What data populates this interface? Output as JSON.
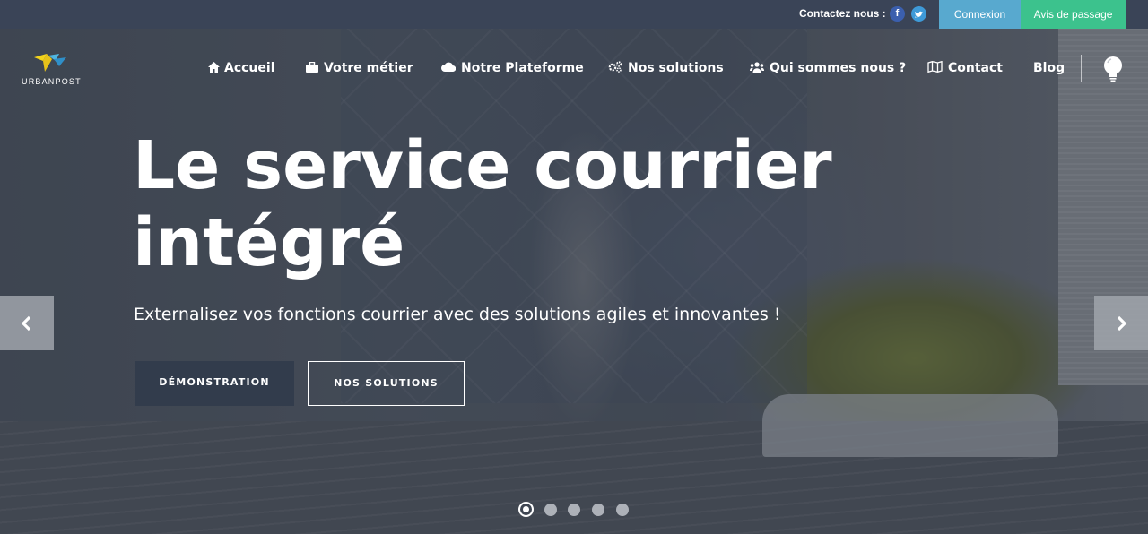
{
  "topbar": {
    "contact_label": "Contactez nous :",
    "social": [
      {
        "name": "facebook-icon",
        "glyph": "f"
      },
      {
        "name": "twitter-icon",
        "glyph": "t"
      }
    ],
    "connexion_label": "Connexion",
    "avis_label": "Avis de passage"
  },
  "logo": {
    "text": "URBANPOST"
  },
  "nav": {
    "items": [
      {
        "label": "Accueil",
        "icon": "home-icon",
        "glyph": "🏠"
      },
      {
        "label": "Votre métier",
        "icon": "briefcase-icon",
        "glyph": "💼"
      },
      {
        "label": "Notre Plateforme",
        "icon": "cloud-icon",
        "glyph": "☁"
      },
      {
        "label": "Nos solutions",
        "icon": "cogs-icon",
        "glyph": "⚙"
      },
      {
        "label": "Qui sommes nous ?",
        "icon": "users-icon",
        "glyph": "👥"
      },
      {
        "label": "Contact",
        "icon": "map-icon",
        "glyph": "🗺"
      },
      {
        "label": "Blog",
        "icon": "",
        "glyph": ""
      }
    ]
  },
  "hero": {
    "headline_line1": "Le service courrier",
    "headline_line2": "intégré",
    "subline": "Externalisez vos fonctions courrier avec des solutions agiles et innovantes !",
    "cta_demo": "DÉMONSTRATION",
    "cta_solutions": "NOS SOLUTIONS"
  },
  "carousel": {
    "slide_count": 5,
    "active_index": 0
  },
  "colors": {
    "topbar_bg": "#3a4457",
    "connexion_bg": "#58a9cf",
    "avis_bg": "#3cc28d",
    "cta_demo_bg": "#323c4c"
  }
}
